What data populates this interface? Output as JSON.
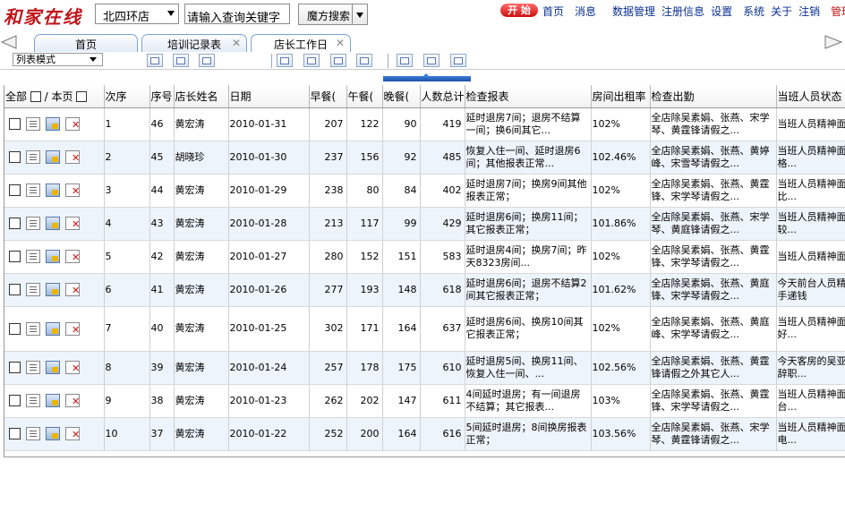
{
  "header": {
    "logo": "和家在线",
    "store_select": "北四环店",
    "search_placeholder": "请输入查询关键字",
    "magic_search": "魔方搜索",
    "start_button": "开 始",
    "nav": [
      "首页",
      "消息",
      "数据管理",
      "注册信息",
      "设置",
      "系统",
      "关于",
      "注销",
      "管理"
    ]
  },
  "tabs": [
    {
      "label": "首页"
    },
    {
      "label": "培训记录表"
    },
    {
      "label": "店长工作日"
    }
  ],
  "toolbar": {
    "view_mode": "列表模式"
  },
  "grid": {
    "headers": {
      "select_all": "全部",
      "separator": "/",
      "this_page": "本页",
      "seq": "次序",
      "num": "序号",
      "manager": "店长姓名",
      "date": "日期",
      "breakfast": "早餐(",
      "lunch": "午餐(",
      "dinner": "晚餐(",
      "total": "人数总计",
      "report": "检查报表",
      "occupancy": "房间出租率",
      "attendance": "检查出勤",
      "staff_status": "当班人员状态"
    },
    "rows": [
      {
        "seq": "1",
        "num": "46",
        "manager": "黄宏涛",
        "date": "2010-01-31",
        "breakfast": "207",
        "lunch": "122",
        "dinner": "90",
        "total": "419",
        "report": "延时退房7间；退房不结算一间；换6间其它...",
        "occupancy": "102%",
        "attendance": "全店除吴素娟、张燕、宋学琴、黄霆锋请假之...",
        "staff": "当班人员精神面表合格；"
      },
      {
        "seq": "2",
        "num": "45",
        "manager": "胡晓珍",
        "date": "2010-01-30",
        "breakfast": "237",
        "lunch": "156",
        "dinner": "92",
        "total": "485",
        "report": "恢复入住一间、延时退房6间；其他报表正常...",
        "occupancy": "102.46%",
        "attendance": "全店除吴素娟、张燕、黄婷峰、宋雪琴请假之...",
        "staff": "当班人员精神面个别不合格..."
      },
      {
        "seq": "3",
        "num": "44",
        "manager": "黄宏涛",
        "date": "2010-01-29",
        "breakfast": "238",
        "lunch": "80",
        "dinner": "84",
        "total": "402",
        "report": "延时退房7间；换房9间其他报表正常；",
        "occupancy": "102%",
        "attendance": "全店除吴素娟、张燕、黄霆锋、宋学琴请假之...",
        "staff": "当班人员精神面最近做的比..."
      },
      {
        "seq": "4",
        "num": "43",
        "manager": "黄宏涛",
        "date": "2010-01-28",
        "breakfast": "213",
        "lunch": "117",
        "dinner": "99",
        "total": "429",
        "report": "延时退房6间；换房11间；其它报表正常；",
        "occupancy": "101.86%",
        "attendance": "全店除吴素娟、张燕、宋学琴、黄庭锋请假之...",
        "staff": "当班人员精神面貌做的比较..."
      },
      {
        "seq": "5",
        "num": "42",
        "manager": "黄宏涛",
        "date": "2010-01-27",
        "breakfast": "280",
        "lunch": "152",
        "dinner": "151",
        "total": "583",
        "report": "延时退房4间；换房7间；昨天8323房间...",
        "occupancy": "102%",
        "attendance": "全店除吴素娟、张燕、黄霆锋、宋学琴请假之...",
        "staff": "当班人员精神面"
      },
      {
        "seq": "6",
        "num": "41",
        "manager": "黄宏涛",
        "date": "2010-01-26",
        "breakfast": "277",
        "lunch": "193",
        "dinner": "148",
        "total": "618",
        "report": "延时退房6间；退房不结算2间其它报表正常；",
        "occupancy": "101.62%",
        "attendance": "全店除吴素娟、张燕、黄庭锋、宋学琴请假之...",
        "staff": "今天前台人员精好！！双手递钱"
      },
      {
        "seq": "7",
        "num": "40",
        "manager": "黄宏涛",
        "date": "2010-01-25",
        "breakfast": "302",
        "lunch": "171",
        "dinner": "164",
        "total": "637",
        "report": "延时退房6间、换房10间其它报表正常；",
        "occupancy": "102%",
        "attendance": "全店除吴素娟、张燕、黄庭峰、宋学琴请假之...",
        "staff": "当班人员精神面做的比较好..."
      },
      {
        "seq": "8",
        "num": "39",
        "manager": "黄宏涛",
        "date": "2010-01-24",
        "breakfast": "257",
        "lunch": "178",
        "dinner": "175",
        "total": "610",
        "report": "延时退房5间、换房11间、恢复入住一间、...",
        "occupancy": "102.56%",
        "attendance": "全店除吴素娟、张燕、黄霆锋请假之外其它人...",
        "staff": "今天客房的吴亚病；所以辞职..."
      },
      {
        "seq": "9",
        "num": "38",
        "manager": "黄宏涛",
        "date": "2010-01-23",
        "breakfast": "262",
        "lunch": "202",
        "dinner": "147",
        "total": "611",
        "report": "4间延时退房；有一间退房不结算；其它报表...",
        "occupancy": "103%",
        "attendance": "全店除吴素娟、张燕、黄霆锋、宋学琴请假之...",
        "staff": "当班人员精神面题就是前台..."
      },
      {
        "seq": "10",
        "num": "37",
        "manager": "黄宏涛",
        "date": "2010-01-22",
        "breakfast": "252",
        "lunch": "200",
        "dinner": "164",
        "total": "616",
        "report": "5间延时退房；8间换房报表正常；",
        "occupancy": "103.56%",
        "attendance": "全店除吴素娟、张燕、宋学琴、黄霆锋请假之...",
        "staff": "当班人员精神面问题接听电..."
      }
    ]
  }
}
